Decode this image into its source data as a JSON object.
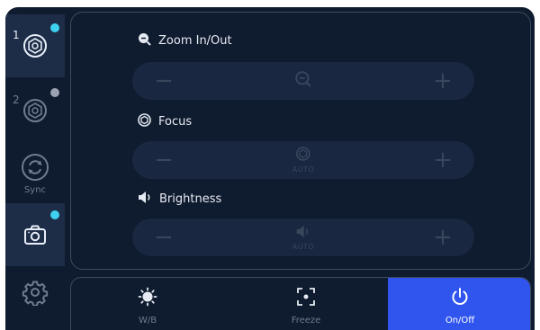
{
  "sidebar": {
    "camera1_number": "1",
    "camera2_number": "2",
    "sync_label": "Sync"
  },
  "controls": {
    "zoom": {
      "title": "Zoom In/Out",
      "minus": "−",
      "plus": "+"
    },
    "focus": {
      "title": "Focus",
      "minus": "−",
      "plus": "+",
      "mode": "AUTO"
    },
    "brightness": {
      "title": "Brightness",
      "minus": "−",
      "plus": "+",
      "mode": "AUTO"
    }
  },
  "bottom_bar": {
    "wb_label": "W/B",
    "freeze_label": "Freeze",
    "onoff_label": "On/Off"
  },
  "colors": {
    "accent_blue": "#2f55ee",
    "status_cyan": "#3ed1f0",
    "status_grey": "#9aa3b2",
    "background": "#0f1b2e"
  },
  "icons": [
    "camera-lens-icon",
    "sync-icon",
    "camera-icon",
    "gear-icon",
    "zoom-icon",
    "focus-icon",
    "brightness-icon",
    "sun-icon",
    "freeze-frame-icon",
    "power-icon"
  ]
}
